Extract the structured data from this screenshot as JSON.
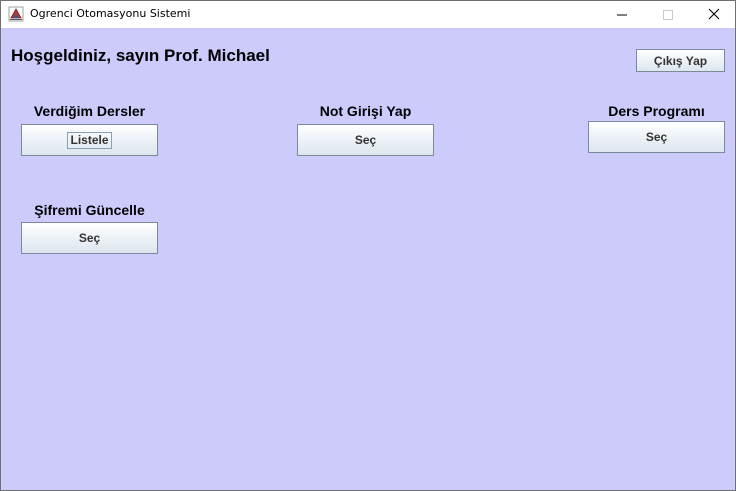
{
  "window": {
    "title": "Ogrenci Otomasyonu Sistemi",
    "icon": "java-app-icon",
    "controls": {
      "minimize": "minimize-icon",
      "maximize": "maximize-icon",
      "close": "close-icon"
    }
  },
  "colors": {
    "content_background": "#cccbfc",
    "button_border": "#7a8a99"
  },
  "header": {
    "welcome_text": "Hoşgeldiniz, sayın Prof. Michael",
    "logout_label": "Çıkış Yap"
  },
  "sections": {
    "courses": {
      "title": "Verdiğim Dersler",
      "button_label": "Listele"
    },
    "grade_entry": {
      "title": "Not Girişi Yap",
      "button_label": "Seç"
    },
    "schedule": {
      "title": "Ders Programı",
      "button_label": "Seç"
    },
    "password": {
      "title": "Şifremi Güncelle",
      "button_label": "Seç"
    }
  }
}
